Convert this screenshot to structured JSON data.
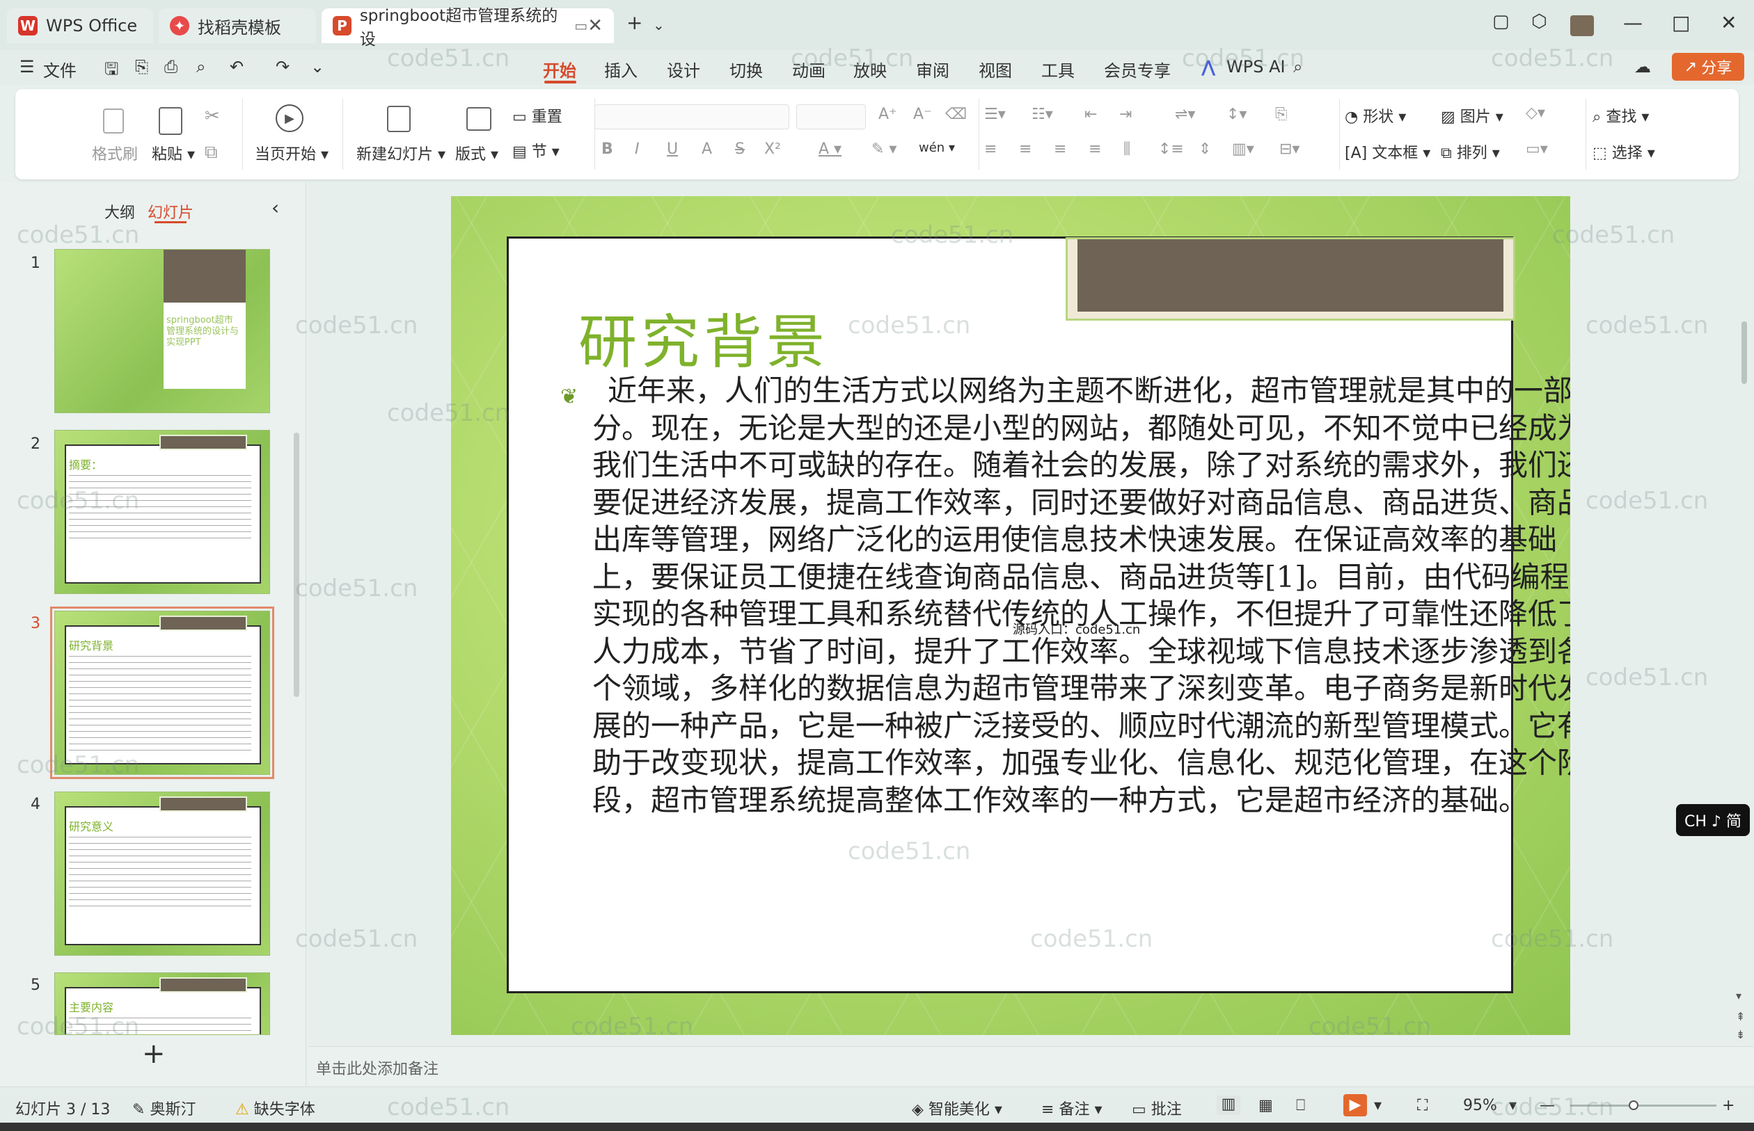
{
  "titlebar": {
    "tabs": [
      {
        "label": "WPS Office",
        "color": "#d7342a"
      },
      {
        "label": "找稻壳模板",
        "color": "#e84a4a"
      },
      {
        "label": "springboot超市管理系统的设",
        "color": "#d74a2c"
      }
    ],
    "new_tab": "+",
    "minimize": "—",
    "maximize": "□",
    "close": "✕"
  },
  "menubar": {
    "file": "文件",
    "items": [
      "开始",
      "插入",
      "设计",
      "切换",
      "动画",
      "放映",
      "审阅",
      "视图",
      "工具",
      "会员专享",
      "WPS AI"
    ],
    "active": "开始",
    "share": "分享"
  },
  "ribbon": {
    "format_painter": "格式刷",
    "paste": "粘贴",
    "play_from_current": "当页开始",
    "new_slide": "新建幻灯片",
    "layout": "版式",
    "section": "节",
    "reset": "重置",
    "shape": "形状",
    "picture": "图片",
    "find": "查找",
    "textbox": "文本框",
    "arrange": "排列",
    "select": "选择",
    "font_bold": "B",
    "font_italic": "I",
    "font_underline": "U",
    "font_A": "A",
    "font_S": "S",
    "superscript": "X²",
    "pinyin": "wén"
  },
  "leftpanel": {
    "tabs": [
      "大纲",
      "幻灯片"
    ],
    "active_tab": "幻灯片",
    "collapse": "‹",
    "thumbnails": [
      {
        "num": "1",
        "title": "springboot超市管理系统的设计与实现PPT"
      },
      {
        "num": "2",
        "title": "摘要："
      },
      {
        "num": "3",
        "title": "研究背景"
      },
      {
        "num": "4",
        "title": "研究意义"
      },
      {
        "num": "5",
        "title": "主要内容"
      }
    ],
    "add": "+"
  },
  "slide": {
    "title": "研究背景",
    "body": "近年来，人们的生活方式以网络为主题不断进化，超市管理就是其中的一部分。现在，无论是大型的还是小型的网站，都随处可见，不知不觉中已经成为我们生活中不可或缺的存在。随着社会的发展，除了对系统的需求外，我们还要促进经济发展，提高工作效率，同时还要做好对商品信息、商品进货、商品出库等管理，网络广泛化的运用使信息技术快速发展。在保证高效率的基础上，要保证员工便捷在线查询商品信息、商品进货等[1]。目前，由代码编程实现的各种管理工具和系统替代传统的人工操作，不但提升了可靠性还降低了人力成本，节省了时间，提升了工作效率。全球视域下信息技术逐步渗透到各个领域，多样化的数据信息为超市管理带来了深刻变革。电子商务是新时代发展的一种产品，它是一种被广泛接受的、顺应时代潮流的新型管理模式。它有助于改变现状，提高工作效率，加强专业化、信息化、规范化管理，在这个阶段，超市管理系统提高整体工作效率的一种方式，它是超市经济的基础。",
    "mini_label": "源码入口：code51.cn"
  },
  "notes": {
    "placeholder": "单击此处添加备注"
  },
  "status": {
    "slide_count": "幻灯片 3 / 13",
    "theme": "奥斯汀",
    "missing_font": "缺失字体",
    "beautify": "智能美化",
    "notes": "备注",
    "comments": "批注",
    "zoom": "95%"
  },
  "ime": "CH ♪ 简",
  "watermark": "code51.cn"
}
